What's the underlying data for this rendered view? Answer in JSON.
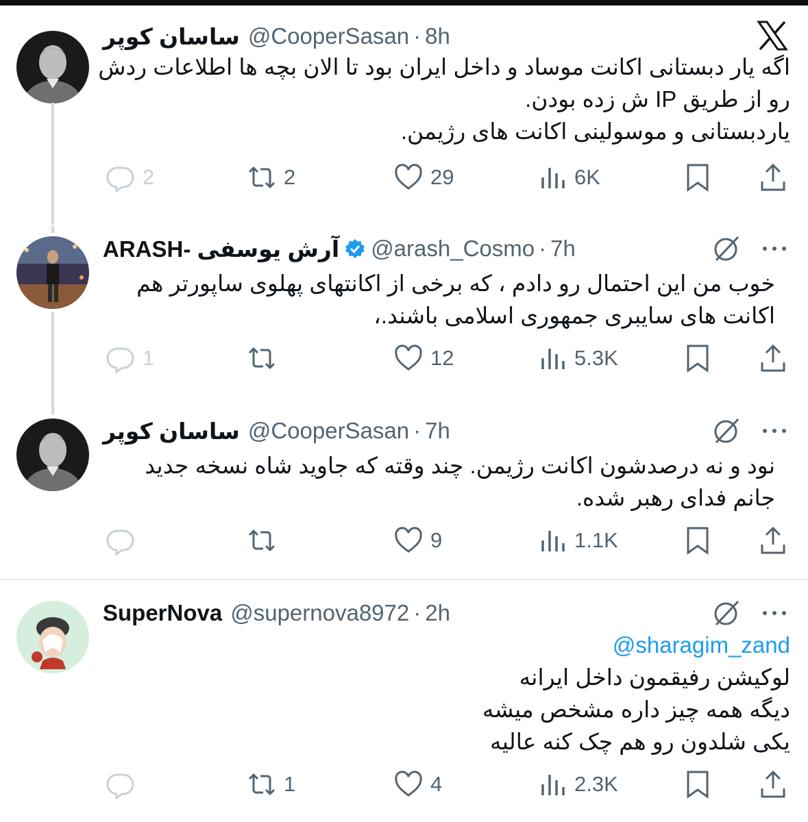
{
  "tweets": [
    {
      "name": "ساسان کوپر",
      "handle": "@CooperSasan",
      "time": "8h",
      "body": [
        "اگه یار دبستانی اکانت موساد و داخل ایران بود تا الان بچه ها اطلاعات ردش",
        "رو از طریق IP ش زده بودن.",
        "یاردبستانی و موسولینی اکانت های رژیمن."
      ],
      "replies": "2",
      "retweets": "2",
      "likes": "29",
      "views": "6K"
    },
    {
      "name": "ARASH- آرش یوسفی",
      "handle": "@arash_Cosmo",
      "time": "7h",
      "body": [
        "خوب من این  احتمال رو دادم ، که برخی از اکانتهای پهلوی ساپورتر هم",
        "اکانت های سایبری جمهوری اسلامی باشند.،"
      ],
      "replies": "1",
      "retweets": "",
      "likes": "12",
      "views": "5.3K"
    },
    {
      "name": "ساسان کوپر",
      "handle": "@CooperSasan",
      "time": "7h",
      "body": [
        "نود و نه درصدشون اکانت رژیمن. چند وقته که جاوید شاه نسخه جدید",
        "جانم فدای رهبر شده."
      ],
      "replies": "",
      "retweets": "",
      "likes": "9",
      "views": "1.1K"
    },
    {
      "name": "SuperNova",
      "handle": "@supernova8972",
      "time": "2h",
      "mention": "@sharagim_zand",
      "body": [
        "لوکیشن رفیقمون داخل ایرانه",
        "دیگه همه چیز داره مشخص میشه",
        "یکی شلدون رو هم چک کنه عالیه"
      ],
      "replies": "",
      "retweets": "1",
      "likes": "4",
      "views": "2.3K"
    }
  ],
  "dot": "·",
  "icons": [
    "x-logo-icon",
    "grok-icon",
    "more-icon",
    "reply-icon",
    "retweet-icon",
    "like-icon",
    "views-icon",
    "bookmark-icon",
    "share-icon",
    "verified-badge-icon"
  ]
}
